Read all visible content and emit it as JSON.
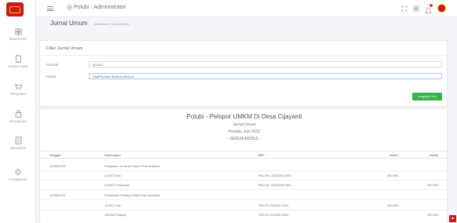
{
  "app": {
    "title": "Polubi - Administrator",
    "logo_text": "POLUBI"
  },
  "sidebar": {
    "items": [
      {
        "label": "Dashboard",
        "icon": "dashboard-icon"
      },
      {
        "label": "Master Data",
        "icon": "document-icon"
      },
      {
        "label": "Penjualan",
        "icon": "cart-icon"
      },
      {
        "label": "Pembelian",
        "icon": "bag-icon"
      },
      {
        "label": "Akuntansi",
        "icon": "ledger-icon"
      },
      {
        "label": "Pengaturan",
        "icon": "settings-icon"
      }
    ]
  },
  "header": {
    "page_title": "Jurnal Umum",
    "breadcrumb": "Akuntansi  |  Jurnal Umum"
  },
  "filter": {
    "title": "Filter Jurnal Umum",
    "period_label": "Periode",
    "period_value": "022023",
    "module_label": "Modul",
    "module_value": "TAMPILKAN SEMUA MODUL",
    "submit_label": "Lengkapi Form"
  },
  "report": {
    "title": "Polubi - Pelopor UMKM Di Desa Cijayanti",
    "subtitle": "Jurnal Umum",
    "period": "Periode Juni 2023",
    "module": "- SEMUA MODUL -",
    "columns": [
      "Tanggal",
      "Keterangan",
      "REF",
      "Debet",
      "Kredit"
    ],
    "rows": [
      {
        "date": "22/06/2023",
        "desc": "Penjualan Tunai ke Olsen Putri Andhara",
        "ref": "",
        "debit": "",
        "credit": ""
      },
      {
        "date": "",
        "desc": "111001 Kas",
        "ref": "PNJ-No. 23Z2606-0001",
        "debit": "450.000",
        "credit": ""
      },
      {
        "date": "",
        "desc": "411001 Penjualan",
        "ref": "PNJ-No. 23Z2606-0001",
        "debit": "",
        "credit": "450.000"
      },
      {
        "date": "22/06/2023",
        "desc": "Pelunasan Piutang Olsen Putri Andhara",
        "ref": "",
        "debit": "",
        "credit": ""
      },
      {
        "date": "",
        "desc": "111001 Kas",
        "ref": "TRX-PI-2Z2606-0002-",
        "debit": "250.000",
        "credit": ""
      },
      {
        "date": "",
        "desc": "112003 Piutang",
        "ref": "TRX-PI-2Z2606-0002-",
        "debit": "",
        "credit": "250.000"
      }
    ]
  },
  "colors": {
    "brand": "#c9181e",
    "accent_gold": "#f2c200",
    "button_green": "#37b24d"
  }
}
